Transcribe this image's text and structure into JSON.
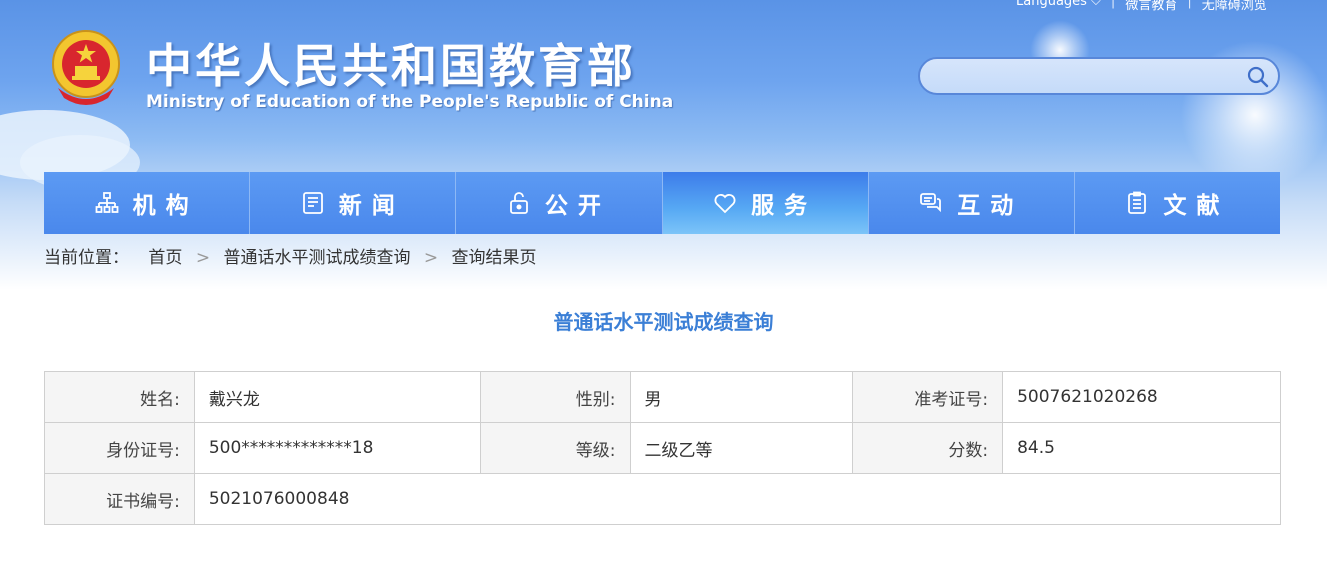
{
  "top_links": [
    "Languages ⌵",
    "微言教育",
    "无障碍浏览"
  ],
  "site": {
    "title": "中华人民共和国教育部",
    "subtitle": "Ministry of Education of the People's Republic of China"
  },
  "search": {
    "placeholder": ""
  },
  "nav": [
    {
      "label": "机构",
      "icon": "org-chart-icon"
    },
    {
      "label": "新闻",
      "icon": "news-icon"
    },
    {
      "label": "公开",
      "icon": "unlock-icon"
    },
    {
      "label": "服务",
      "icon": "heart-icon"
    },
    {
      "label": "互动",
      "icon": "chat-icon"
    },
    {
      "label": "文献",
      "icon": "clipboard-icon"
    }
  ],
  "breadcrumb": {
    "prefix": "当前位置：",
    "items": [
      "首页",
      "普通话水平测试成绩查询",
      "查询结果页"
    ],
    "separator": ">"
  },
  "page_title": "普通话水平测试成绩查询",
  "result": {
    "name_label": "姓名:",
    "name_value": "戴兴龙",
    "gender_label": "性别:",
    "gender_value": "男",
    "ticket_label": "准考证号:",
    "ticket_value": "5007621020268",
    "id_label": "身份证号:",
    "id_value": "500*************18",
    "level_label": "等级:",
    "level_value": "二级乙等",
    "score_label": "分数:",
    "score_value": "84.5",
    "cert_label": "证书编号:",
    "cert_value": "5021076000848"
  },
  "colors": {
    "nav_blue": "#4a88ec",
    "nav_active": "#57a9f4",
    "title_blue": "#3b7fd6",
    "label_bg": "#f5f5f5",
    "border": "#cfcfcf"
  }
}
